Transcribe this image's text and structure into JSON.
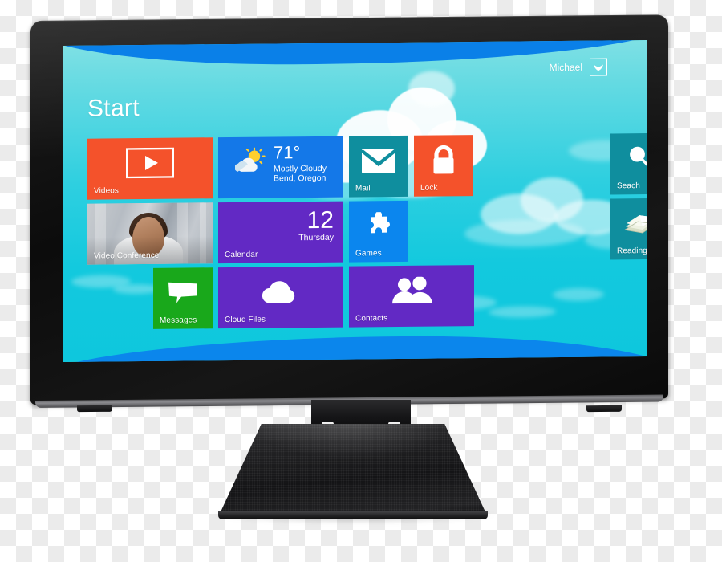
{
  "device": {
    "type": "touchscreen-monitor",
    "bezel_color": "#111111",
    "stand_color": "#1a1a1c"
  },
  "screen": {
    "os": "Windows 8 Start screen",
    "title": "Start",
    "background_colors": {
      "sky_top": "#7ee0e4",
      "sky_bottom": "#0ec7dd",
      "wave_blue": "#0a80e8"
    },
    "user": {
      "name": "Michael",
      "avatar_icon": "bird-avatar-icon"
    },
    "tiles": [
      {
        "id": "videos",
        "label": "Videos",
        "color": "#f4522b",
        "icon": "play-button-icon",
        "size": "wide",
        "row": 1
      },
      {
        "id": "weather",
        "label": "",
        "color": "#1478e8",
        "icon": "sun-behind-cloud-icon",
        "size": "wide",
        "row": 1,
        "temperature": "71°",
        "condition": "Mostly Cloudy",
        "location": "Bend, Oregon"
      },
      {
        "id": "mail",
        "label": "Mail",
        "color": "#0f8e9e",
        "icon": "envelope-icon",
        "size": "square",
        "row": 1
      },
      {
        "id": "lock",
        "label": "Lock",
        "color": "#f4522b",
        "icon": "padlock-icon",
        "size": "square",
        "row": 1
      },
      {
        "id": "search",
        "label": "Seach",
        "color": "#0f8e9e",
        "icon": "magnifier-icon",
        "size": "square",
        "row": 1
      },
      {
        "id": "video-conference",
        "label": "Video Conference",
        "color": "#b9bfc5",
        "icon": "person-photo",
        "size": "wide",
        "row": 2
      },
      {
        "id": "calendar",
        "label": "Calendar",
        "color": "#6229c4",
        "icon": "date-number",
        "size": "wide",
        "row": 2,
        "day_number": "12",
        "day_name": "Thursday"
      },
      {
        "id": "games",
        "label": "Games",
        "color": "#0b86ee",
        "icon": "puzzle-piece-icon",
        "size": "square",
        "row": 2
      },
      {
        "id": "reading",
        "label": "Reading",
        "color": "#0f8e9e",
        "icon": "open-book-icon",
        "size": "square",
        "row": 2
      },
      {
        "id": "messages",
        "label": "Messages",
        "color": "#19a81b",
        "icon": "speech-bubble-icon",
        "size": "square",
        "row": 3
      },
      {
        "id": "cloud-files",
        "label": "Cloud Files",
        "color": "#6229c4",
        "icon": "cloud-icon",
        "size": "wide",
        "row": 3
      },
      {
        "id": "contacts",
        "label": "Contacts",
        "color": "#6229c4",
        "icon": "two-people-icon",
        "size": "wide",
        "row": 3
      }
    ]
  }
}
